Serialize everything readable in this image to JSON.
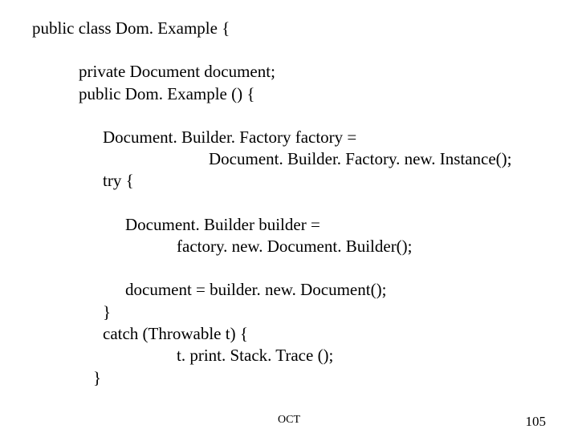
{
  "code": {
    "l1": "public class Dom. Example {",
    "l2": "private Document document;",
    "l3": "public Dom. Example () {",
    "l4": "Document. Builder. Factory factory =",
    "l5": "Document. Builder. Factory. new. Instance();",
    "l6": "try {",
    "l7": "Document. Builder builder =",
    "l8": "factory. new. Document. Builder();",
    "l9": "document = builder. new. Document();",
    "l10": "}",
    "l11": "catch (Throwable t) {",
    "l12": "t. print. Stack. Trace ();",
    "l13": "}"
  },
  "footer": {
    "center": "OCT",
    "right": "105"
  }
}
